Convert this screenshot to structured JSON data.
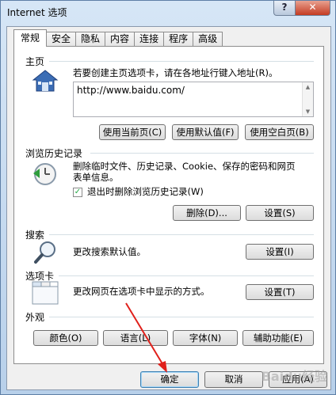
{
  "window": {
    "title": "Internet 选项",
    "help_label": "?",
    "close_label": "✕"
  },
  "tabs": [
    {
      "label": "常规"
    },
    {
      "label": "安全"
    },
    {
      "label": "隐私"
    },
    {
      "label": "内容"
    },
    {
      "label": "连接"
    },
    {
      "label": "程序"
    },
    {
      "label": "高级"
    }
  ],
  "home": {
    "section": "主页",
    "desc": "若要创建主页选项卡，请在各地址行键入地址(R)。",
    "url": "http://www.baidu.com/",
    "btn_current": "使用当前页(C)",
    "btn_default": "使用默认值(F)",
    "btn_blank": "使用空白页(B)"
  },
  "history": {
    "section": "浏览历史记录",
    "desc_line1": "删除临时文件、历史记录、Cookie、保存的密码和网页",
    "desc_line2": "表单信息。",
    "checkbox_label": "退出时删除浏览历史记录(W)",
    "checked_mark": "✓",
    "btn_delete": "删除(D)...",
    "btn_settings": "设置(S)"
  },
  "search": {
    "section": "搜索",
    "desc": "更改搜索默认值。",
    "btn_settings": "设置(I)"
  },
  "tabs_section": {
    "section": "选项卡",
    "desc": "更改网页在选项卡中显示的方式。",
    "btn_settings": "设置(T)"
  },
  "appearance": {
    "section": "外观",
    "btn_colors": "颜色(O)",
    "btn_languages": "语言(L)",
    "btn_fonts": "字体(N)",
    "btn_accessibility": "辅助功能(E)"
  },
  "footer": {
    "ok": "确定",
    "cancel": "取消",
    "apply": "应用(A)"
  },
  "watermark": "Baidu经验",
  "colors": {
    "arrow": "#e0201b",
    "accent": "#3c7fb1"
  }
}
